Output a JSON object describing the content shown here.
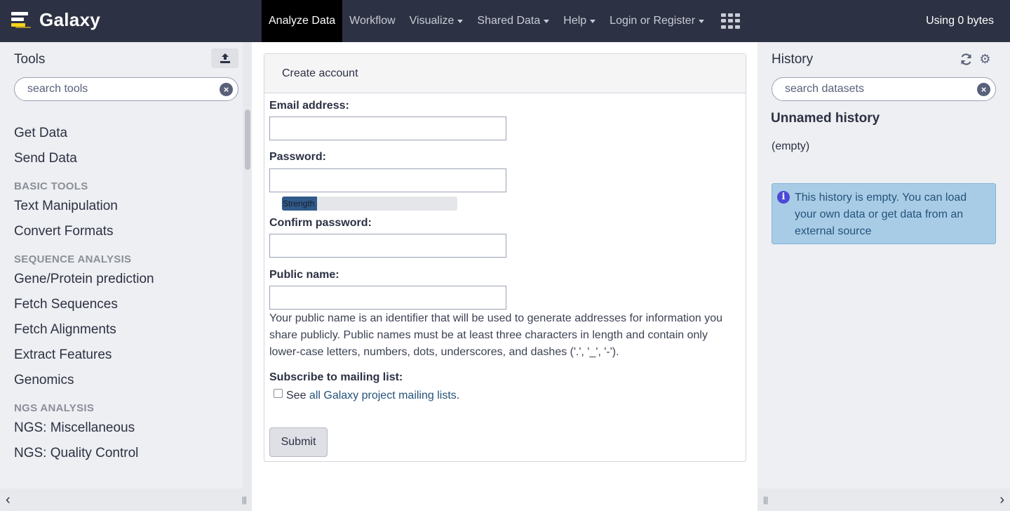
{
  "masthead": {
    "brand": "Galaxy",
    "nav": [
      {
        "label": "Analyze Data",
        "active": true,
        "dropdown": false
      },
      {
        "label": "Workflow",
        "active": false,
        "dropdown": false
      },
      {
        "label": "Visualize",
        "active": false,
        "dropdown": true
      },
      {
        "label": "Shared Data",
        "active": false,
        "dropdown": true
      },
      {
        "label": "Help",
        "active": false,
        "dropdown": true
      },
      {
        "label": "Login or Register",
        "active": false,
        "dropdown": true
      }
    ],
    "apps_icon": "grid-icon",
    "quota": "Using 0 bytes",
    "colors": {
      "background": "#2c3143",
      "active": "#000000",
      "logo_accent": "#f7d21c"
    }
  },
  "tools": {
    "title": "Tools",
    "upload_icon": "upload-icon",
    "search_placeholder": "search tools",
    "items": [
      {
        "type": "link",
        "label": "Get Data"
      },
      {
        "type": "link",
        "label": "Send Data"
      },
      {
        "type": "section",
        "label": "BASIC TOOLS"
      },
      {
        "type": "link",
        "label": "Text Manipulation"
      },
      {
        "type": "link",
        "label": "Convert Formats"
      },
      {
        "type": "section",
        "label": "SEQUENCE ANALYSIS"
      },
      {
        "type": "link",
        "label": "Gene/Protein prediction"
      },
      {
        "type": "link",
        "label": "Fetch Sequences"
      },
      {
        "type": "link",
        "label": "Fetch Alignments"
      },
      {
        "type": "link",
        "label": "Extract Features"
      },
      {
        "type": "link",
        "label": "Genomics"
      },
      {
        "type": "section",
        "label": "NGS ANALYSIS"
      },
      {
        "type": "link",
        "label": "NGS: Miscellaneous"
      },
      {
        "type": "link",
        "label": "NGS: Quality Control"
      }
    ]
  },
  "form": {
    "header": "Create account",
    "email_label": "Email address:",
    "email_value": "",
    "password_label": "Password:",
    "password_value": "",
    "strength_label": "Strength",
    "strength_fraction": 0.2,
    "confirm_label": "Confirm password:",
    "confirm_value": "",
    "public_name_label": "Public name:",
    "public_name_value": "",
    "public_name_help": "Your public name is an identifier that will be used to generate addresses for information you share publicly. Public names must be at least three characters in length and contain only lower-case letters, numbers, dots, underscores, and dashes ('.', '_', '-').",
    "subscribe_label": "Subscribe to mailing list:",
    "subscribe_checked": false,
    "subscribe_prefix": "See ",
    "subscribe_link": "all Galaxy project mailing lists",
    "subscribe_suffix": ".",
    "submit_label": "Submit"
  },
  "history": {
    "title": "History",
    "refresh_icon": "refresh-icon",
    "options_icon": "gear-icon",
    "search_placeholder": "search datasets",
    "name": "Unnamed history",
    "size": "(empty)",
    "info_icon": "info-icon",
    "info_message": "This history is empty. You can load your own data or get data from an external source",
    "colors": {
      "info_bg": "#a8cce6",
      "info_text": "#25537b"
    }
  },
  "bottom": {
    "collapse_left_icon": "chevron-left-icon",
    "collapse_right_icon": "chevron-right-icon",
    "drag_handle": "|||"
  }
}
